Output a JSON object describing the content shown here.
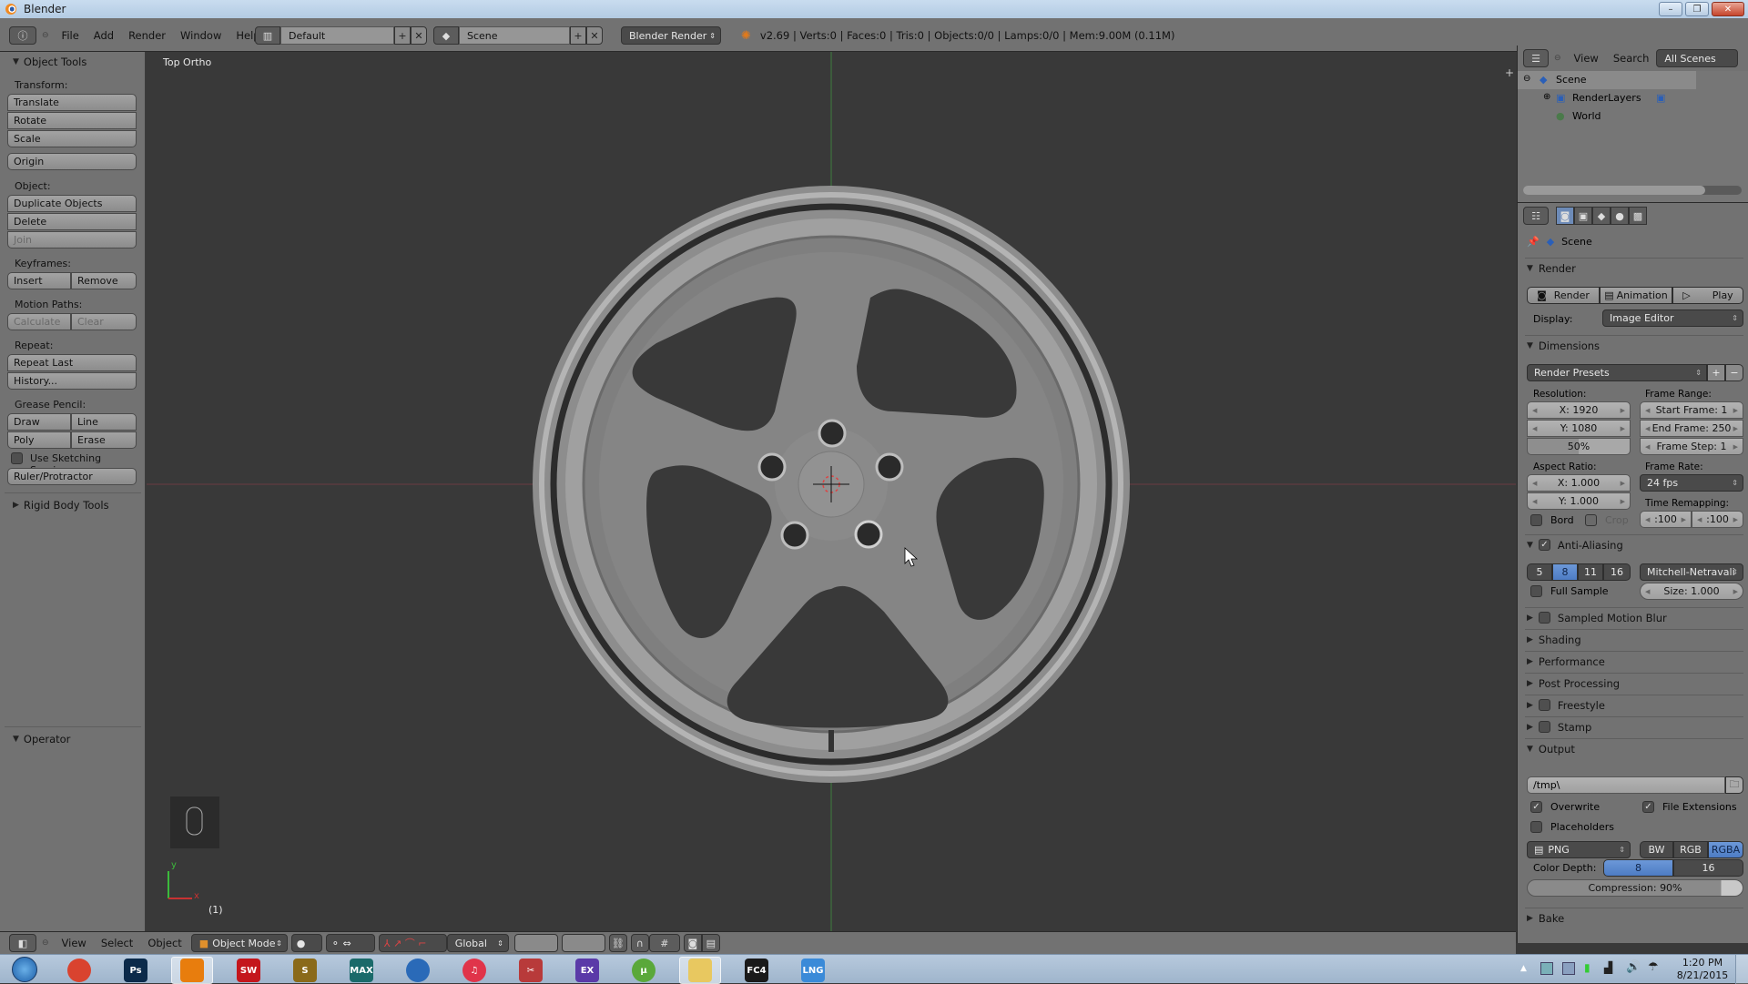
{
  "window": {
    "title": "Blender",
    "controls": {
      "minimize": "–",
      "maximize": "❐",
      "close": "✕"
    }
  },
  "info_header": {
    "editor_icon": "info-icon",
    "menus": [
      "File",
      "Add",
      "Render",
      "Window",
      "Help"
    ],
    "screen_layout": "Default",
    "scene": "Scene",
    "render_engine": "Blender Render",
    "stats": "v2.69 | Verts:0 | Faces:0 | Tris:0 | Objects:0/0 | Lamps:0/0 | Mem:9.00M (0.11M)"
  },
  "tool_shelf": {
    "object_tools_title": "Object Tools",
    "transform_label": "Transform:",
    "translate": "Translate",
    "rotate": "Rotate",
    "scale": "Scale",
    "origin": "Origin",
    "object_label": "Object:",
    "duplicate": "Duplicate Objects",
    "delete": "Delete",
    "join": "Join",
    "keyframes_label": "Keyframes:",
    "insert": "Insert",
    "remove": "Remove",
    "motion_paths_label": "Motion Paths:",
    "calculate": "Calculate",
    "clear": "Clear",
    "repeat_label": "Repeat:",
    "repeat_last": "Repeat Last",
    "history": "History...",
    "grease_label": "Grease Pencil:",
    "draw": "Draw",
    "line": "Line",
    "poly": "Poly",
    "erase": "Erase",
    "sketching": "Use Sketching Sessions",
    "sketching_checked": false,
    "ruler": "Ruler/Protractor",
    "rigid_body_title": "Rigid Body Tools",
    "operator_title": "Operator"
  },
  "viewport": {
    "view_label": "Top Ortho",
    "frame_indicator": "(1)",
    "axis_x": "x",
    "axis_y": "y"
  },
  "view3d_header": {
    "menus": [
      "View",
      "Select",
      "Object"
    ],
    "mode": "Object Mode",
    "orientation": "Global"
  },
  "outliner": {
    "menus": [
      "View",
      "Search"
    ],
    "display": "All Scenes",
    "tree": [
      {
        "label": "Scene",
        "level": 0
      },
      {
        "label": "RenderLayers",
        "level": 1
      },
      {
        "label": "World",
        "level": 1
      }
    ]
  },
  "properties": {
    "context": "Scene",
    "render_section": "Render",
    "render_btn": "Render",
    "animation_btn": "Animation",
    "play_btn": "Play",
    "display_label": "Display:",
    "display_value": "Image Editor",
    "dimensions_section": "Dimensions",
    "render_presets": "Render Presets",
    "resolution_label": "Resolution:",
    "res_x": "X: 1920",
    "res_y": "Y: 1080",
    "res_pct": "50%",
    "res_pct_value": 0.5,
    "frame_range_label": "Frame Range:",
    "start_frame": "Start Frame: 1",
    "end_frame": "End Frame: 250",
    "frame_step": "Frame Step: 1",
    "aspect_label": "Aspect Ratio:",
    "aspect_x": "X: 1.000",
    "aspect_y": "Y: 1.000",
    "frame_rate_label": "Frame Rate:",
    "frame_rate": "24 fps",
    "time_remap_label": "Time Remapping:",
    "remap_old": ":100",
    "remap_new": ":100",
    "bord": "Bord",
    "crop": "Crop",
    "aa_section": "Anti-Aliasing",
    "aa_samples": [
      "5",
      "8",
      "11",
      "16"
    ],
    "aa_selected": "8",
    "aa_filter": "Mitchell-Netravali",
    "full_sample": "Full Sample",
    "aa_size": "Size: 1.000",
    "collapsed_sections": [
      {
        "label": "Sampled Motion Blur",
        "checkbox": true
      },
      {
        "label": "Shading",
        "checkbox": false
      },
      {
        "label": "Performance",
        "checkbox": false
      },
      {
        "label": "Post Processing",
        "checkbox": false
      },
      {
        "label": "Freestyle",
        "checkbox": true
      },
      {
        "label": "Stamp",
        "checkbox": true
      }
    ],
    "output_section": "Output",
    "output_path": "/tmp\\",
    "overwrite": "Overwrite",
    "overwrite_checked": true,
    "file_ext": "File Extensions",
    "file_ext_checked": true,
    "placeholders": "Placeholders",
    "placeholders_checked": false,
    "format": "PNG",
    "color_modes": [
      "BW",
      "RGB",
      "RGBA"
    ],
    "color_mode_selected": "RGBA",
    "color_depth_label": "Color Depth:",
    "color_depths": [
      "8",
      "16"
    ],
    "color_depth_selected": "8",
    "compression": "Compression: 90%",
    "compression_value": 0.9,
    "bake_section": "Bake"
  },
  "taskbar": {
    "apps": [
      {
        "name": "chrome",
        "label": ""
      },
      {
        "name": "photoshop",
        "label": "Ps"
      },
      {
        "name": "blender",
        "label": "",
        "active": true
      },
      {
        "name": "solidworks",
        "label": "SW"
      },
      {
        "name": "app-s",
        "label": "S"
      },
      {
        "name": "3dsmax",
        "label": "MAX"
      },
      {
        "name": "keyshot",
        "label": ""
      },
      {
        "name": "itunes",
        "label": "♫"
      },
      {
        "name": "snipping-tool",
        "label": "✂"
      },
      {
        "name": "video-editor",
        "label": "EX"
      },
      {
        "name": "utorrent",
        "label": "µ"
      },
      {
        "name": "file-explorer",
        "label": "",
        "active": true
      },
      {
        "name": "fc4",
        "label": "FC4"
      },
      {
        "name": "lng",
        "label": "LNG"
      }
    ],
    "clock_time": "1:20 PM",
    "clock_date": "8/21/2015"
  }
}
